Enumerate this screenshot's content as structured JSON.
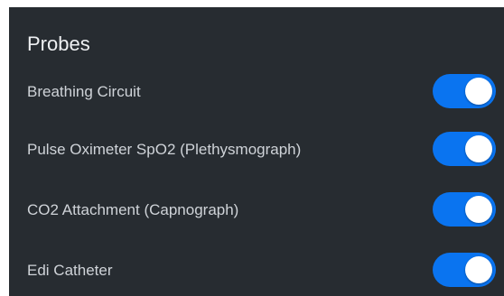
{
  "section": {
    "title": "Probes"
  },
  "colors": {
    "panel_background": "#272c31",
    "toggle_on": "#0a74f0",
    "text": "#cfd3d8"
  },
  "probes": [
    {
      "label": "Breathing Circuit",
      "enabled": true
    },
    {
      "label": "Pulse Oximeter SpO2 (Plethysmograph)",
      "enabled": true
    },
    {
      "label": "CO2 Attachment (Capnograph)",
      "enabled": true
    },
    {
      "label": "Edi Catheter",
      "enabled": true
    }
  ]
}
